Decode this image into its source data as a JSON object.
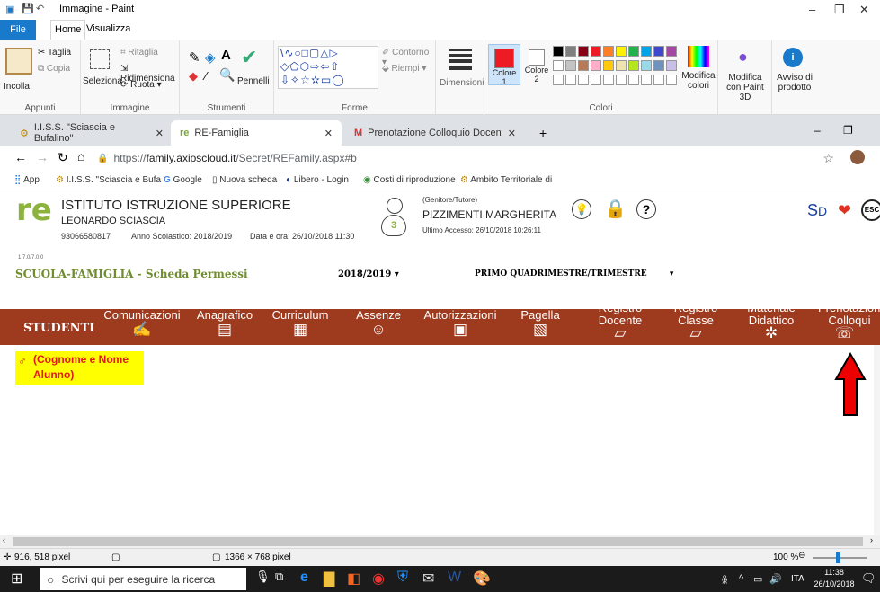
{
  "paint": {
    "title": "Immagine - Paint",
    "tabs": [
      "File",
      "Home",
      "Visualizza"
    ],
    "clipboard": {
      "paste": "Incolla",
      "cut": "Taglia",
      "copy": "Copia",
      "label": "Appunti"
    },
    "image": {
      "select": "Seleziona",
      "crop": "Ritaglia",
      "resize": "Ridimensiona",
      "rotate": "Ruota",
      "label": "Immagine"
    },
    "tools": {
      "label": "Strumenti",
      "brushes": "Pennelli"
    },
    "shapes": {
      "outline": "Contorno",
      "fill": "Riempi",
      "label": "Forme"
    },
    "size": "Dimensioni",
    "colors": {
      "color1": "Colore 1",
      "color2": "Colore 2",
      "edit": "Modifica colori",
      "label": "Colori"
    },
    "paint3d": "Modifica con Paint 3D",
    "notice": "Avviso di prodotto",
    "palette": [
      "#000000",
      "#7f7f7f",
      "#880015",
      "#ed1c24",
      "#ff7f27",
      "#fff200",
      "#22b14c",
      "#00a2e8",
      "#3f48cc",
      "#a349a4",
      "#ffffff",
      "#c3c3c3",
      "#b97a57",
      "#ffaec9",
      "#ffc90e",
      "#efe4b0",
      "#b5e61d",
      "#99d9ea",
      "#7092be",
      "#c8bfe7"
    ],
    "status": {
      "coords": "916, 518 pixel",
      "size": "1366 × 768 pixel",
      "zoom": "100 %"
    }
  },
  "browser": {
    "tabs": [
      "I.I.S.S. \"Sciascia e Bufalino\"",
      "RE-Famiglia",
      "Prenotazione Colloquio Docenti"
    ],
    "url_prefix": "https://",
    "url_host": "family.axioscloud.it",
    "url_path": "/Secret/REFamily.aspx#b",
    "bookmarks": [
      "App",
      "I.I.S.S. \"Sciascia e Bufa",
      "Google",
      "Nuova scheda",
      "Libero - Login",
      "Costi di riproduzione",
      "Ambito Territoriale di"
    ]
  },
  "site": {
    "school": "ISTITUTO ISTRUZIONE SUPERIORE",
    "school2": "LEONARDO SCIASCIA",
    "phone": "93066580817",
    "year_info": "Anno Scolastico: 2018/2019",
    "datetime": "Data e ora: 26/10/2018 11:30",
    "version": "1.7.0/7.0.0",
    "role": "(Genitore/Tutore)",
    "user": "PIZZIMENTI MARGHERITA",
    "last_access": "Ultimo Accesso: 26/10/2018 10:26:11",
    "badge": "3",
    "section": "SCUOLA-FAMIGLIA - Scheda Permessi",
    "year": "2018/2019",
    "period": "PRIMO QUADRIMESTRE/TRIMESTRE",
    "menu_left": "STUDENTI",
    "menu": [
      "Comunicazioni",
      "Anagrafico",
      "Curriculum",
      "Assenze",
      "Autorizzazioni",
      "Pagella",
      "Registro Docente",
      "Registro Classe",
      "Materiale Didattico",
      "Prenotazioni Colloqui"
    ],
    "student": "(Cognome e Nome Alunno)"
  },
  "taskbar": {
    "search": "Scrivi qui per eseguire la ricerca",
    "lang": "ITA",
    "time": "11:38",
    "date": "26/10/2018"
  }
}
